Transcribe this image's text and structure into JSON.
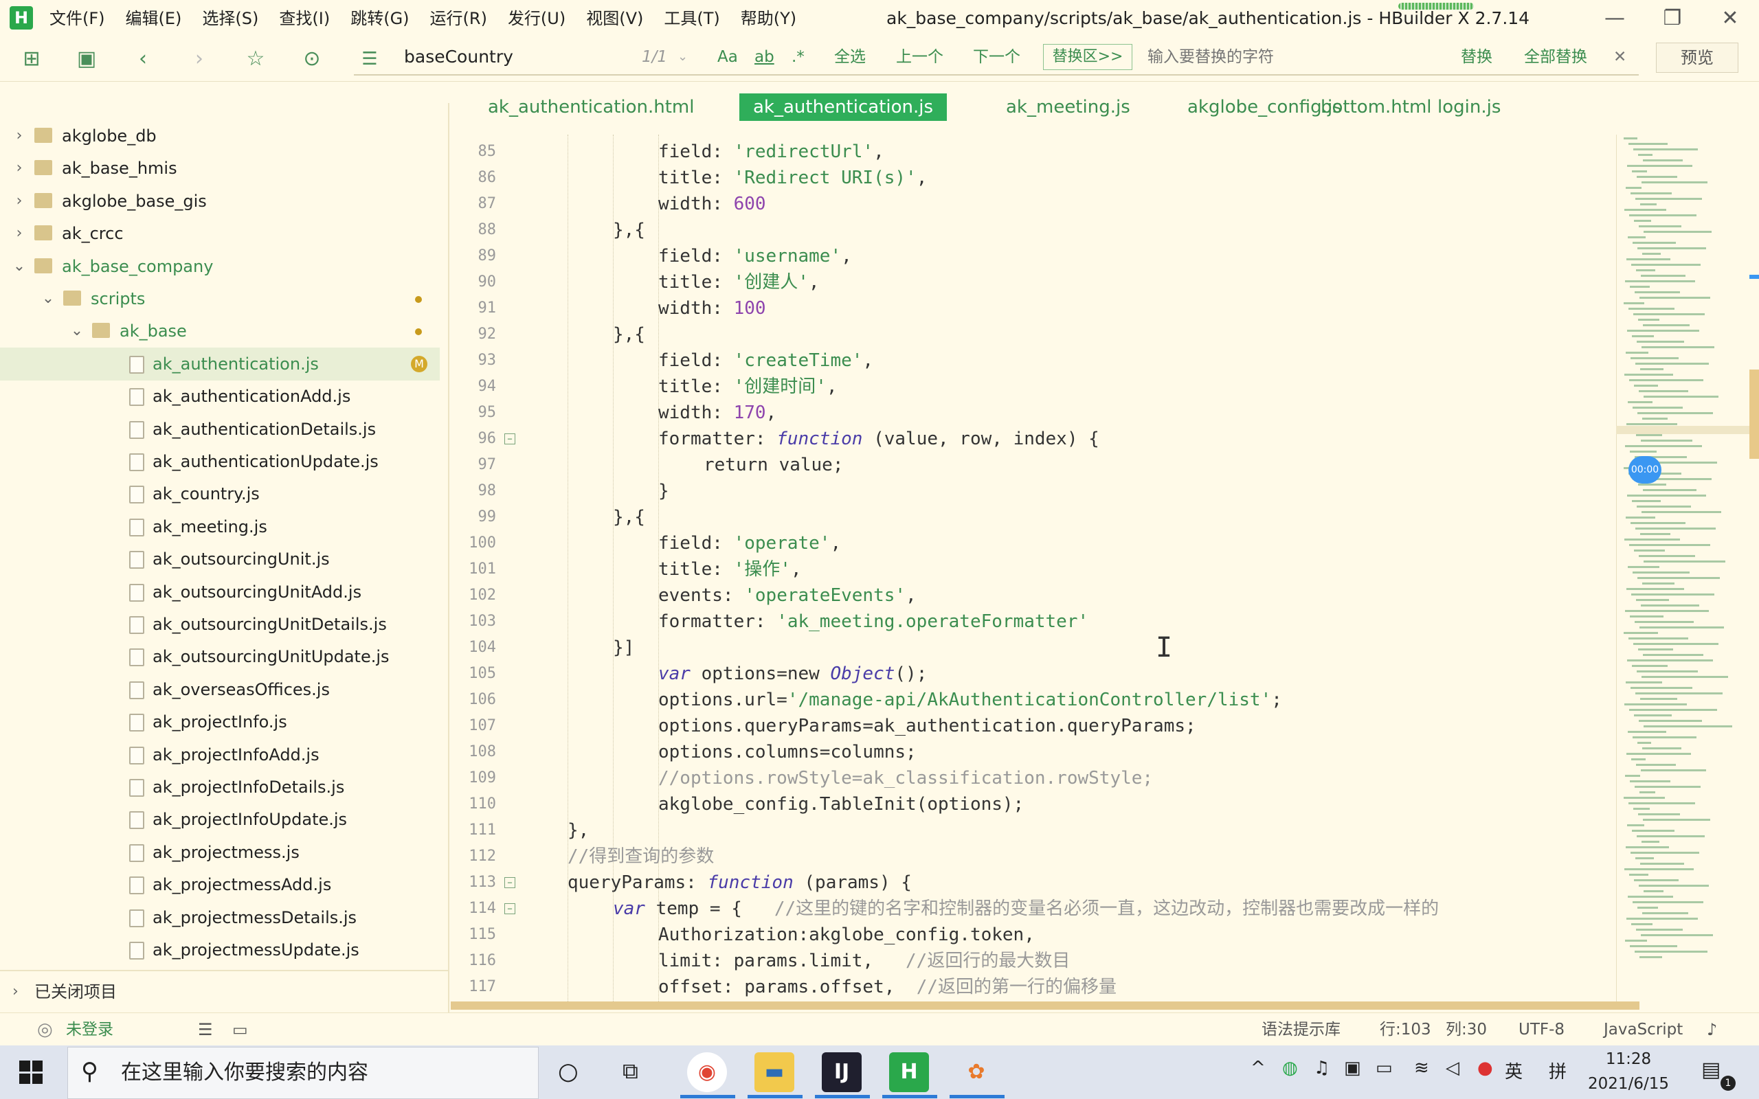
{
  "window": {
    "app_logo": "H",
    "title": "ak_base_company/scripts/ak_base/ak_authentication.js - HBuilder X 2.7.14",
    "controls": [
      "—",
      "❐",
      "✕"
    ]
  },
  "menu": [
    "文件(F)",
    "编辑(E)",
    "选择(S)",
    "查找(I)",
    "跳转(G)",
    "运行(R)",
    "发行(U)",
    "视图(V)",
    "工具(T)",
    "帮助(Y)"
  ],
  "find_bar": {
    "query": "baseCountry",
    "match_count": "1/1",
    "case_toggle": "Aa",
    "word_toggle": "ab",
    "regex_toggle": ".*",
    "select_all": "全选",
    "prev": "上一个",
    "next": "下一个",
    "replace_zone": "替换区>>",
    "replace_placeholder": "输入要替换的字符",
    "replace": "替换",
    "replace_all": "全部替换",
    "close": "✕",
    "preview": "预览"
  },
  "sidebar": {
    "items": [
      {
        "label": "akglobe_db",
        "type": "project",
        "state": "collapsed"
      },
      {
        "label": "ak_base_hmis",
        "type": "project",
        "state": "collapsed"
      },
      {
        "label": "akglobe_base_gis",
        "type": "project",
        "state": "collapsed"
      },
      {
        "label": "ak_crcc",
        "type": "project",
        "state": "collapsed"
      },
      {
        "label": "ak_base_company",
        "type": "project",
        "state": "expanded"
      },
      {
        "label": "scripts",
        "type": "folder",
        "state": "expanded",
        "modified": true
      },
      {
        "label": "ak_base",
        "type": "folder",
        "state": "expanded",
        "modified": true
      },
      {
        "label": "ak_authentication.js",
        "type": "file",
        "selected": true,
        "badge": "M"
      },
      {
        "label": "ak_authenticationAdd.js",
        "type": "file"
      },
      {
        "label": "ak_authenticationDetails.js",
        "type": "file"
      },
      {
        "label": "ak_authenticationUpdate.js",
        "type": "file"
      },
      {
        "label": "ak_country.js",
        "type": "file"
      },
      {
        "label": "ak_meeting.js",
        "type": "file"
      },
      {
        "label": "ak_outsourcingUnit.js",
        "type": "file"
      },
      {
        "label": "ak_outsourcingUnitAdd.js",
        "type": "file"
      },
      {
        "label": "ak_outsourcingUnitDetails.js",
        "type": "file"
      },
      {
        "label": "ak_outsourcingUnitUpdate.js",
        "type": "file"
      },
      {
        "label": "ak_overseasOffices.js",
        "type": "file"
      },
      {
        "label": "ak_projectInfo.js",
        "type": "file"
      },
      {
        "label": "ak_projectInfoAdd.js",
        "type": "file"
      },
      {
        "label": "ak_projectInfoDetails.js",
        "type": "file"
      },
      {
        "label": "ak_projectInfoUpdate.js",
        "type": "file"
      },
      {
        "label": "ak_projectmess.js",
        "type": "file"
      },
      {
        "label": "ak_projectmessAdd.js",
        "type": "file"
      },
      {
        "label": "ak_projectmessDetails.js",
        "type": "file"
      },
      {
        "label": "ak_projectmessUpdate.js",
        "type": "file"
      }
    ],
    "closed_projects": "已关闭项目"
  },
  "tabs": [
    {
      "label": "ak_authentication.html",
      "active": false
    },
    {
      "label": "ak_authentication.js",
      "active": true
    },
    {
      "label": "ak_meeting.js",
      "active": false
    },
    {
      "label": "akglobe_config.js",
      "active": false
    },
    {
      "label": "bottom.html",
      "active": false
    },
    {
      "label": "login.js",
      "active": false
    }
  ],
  "code": [
    {
      "n": "85",
      "indent": 12,
      "html": "field: <span class=\"str\">'redirectUrl'</span>,"
    },
    {
      "n": "86",
      "indent": 12,
      "html": "title: <span class=\"str\">'Redirect URI(s)'</span>,"
    },
    {
      "n": "87",
      "indent": 12,
      "html": "width: <span class=\"num\">600</span>"
    },
    {
      "n": "88",
      "indent": 8,
      "html": "},{"
    },
    {
      "n": "89",
      "indent": 12,
      "html": "field: <span class=\"str\">'username'</span>,"
    },
    {
      "n": "90",
      "indent": 12,
      "html": "title: <span class=\"str\">'创建人'</span>,"
    },
    {
      "n": "91",
      "indent": 12,
      "html": "width: <span class=\"num\">100</span>"
    },
    {
      "n": "92",
      "indent": 8,
      "html": "},{"
    },
    {
      "n": "93",
      "indent": 12,
      "html": "field: <span class=\"str\">'createTime'</span>,"
    },
    {
      "n": "94",
      "indent": 12,
      "html": "title: <span class=\"str\">'创建时间'</span>,"
    },
    {
      "n": "95",
      "indent": 12,
      "html": "width: <span class=\"num\">170</span>,"
    },
    {
      "n": "96",
      "indent": 12,
      "fold": true,
      "html": "formatter: <span class=\"fn\">function</span> (value, row, index) {"
    },
    {
      "n": "97",
      "indent": 16,
      "html": "return value;"
    },
    {
      "n": "98",
      "indent": 12,
      "html": "}"
    },
    {
      "n": "99",
      "indent": 8,
      "html": "},{"
    },
    {
      "n": "100",
      "indent": 12,
      "html": "field: <span class=\"str\">'operate'</span>,"
    },
    {
      "n": "101",
      "indent": 12,
      "html": "title: <span class=\"str\">'操作'</span>,"
    },
    {
      "n": "102",
      "indent": 12,
      "html": "events: <span class=\"str\">'operateEvents'</span>,"
    },
    {
      "n": "103",
      "indent": 12,
      "html": "formatter: <span class=\"str\">'ak_meeting.operateFormatter'</span>"
    },
    {
      "n": "104",
      "indent": 8,
      "html": "}]"
    },
    {
      "n": "105",
      "indent": 12,
      "html": "<span class=\"fn\">var</span> options=new <span class=\"fn\">Object</span>();"
    },
    {
      "n": "106",
      "indent": 12,
      "html": "options.url=<span class=\"str\">'/manage-api/AkAuthenticationController/list'</span>;"
    },
    {
      "n": "107",
      "indent": 12,
      "html": "options.queryParams=ak_authentication.queryParams;"
    },
    {
      "n": "108",
      "indent": 12,
      "html": "options.columns=columns;"
    },
    {
      "n": "109",
      "indent": 12,
      "html": "<span class=\"cm\">//options.rowStyle=ak_classification.rowStyle;</span>"
    },
    {
      "n": "110",
      "indent": 12,
      "html": "akglobe_config.TableInit(options);"
    },
    {
      "n": "111",
      "indent": 4,
      "html": "},"
    },
    {
      "n": "112",
      "indent": 4,
      "html": "<span class=\"cm\">//得到查询的参数</span>"
    },
    {
      "n": "113",
      "indent": 4,
      "fold": true,
      "html": "queryParams: <span class=\"fn\">function</span> (params) {"
    },
    {
      "n": "114",
      "indent": 8,
      "fold": true,
      "html": "<span class=\"fn\">var</span> temp = {   <span class=\"cm\">//这里的键的名字和控制器的变量名必须一直，这边改动，控制器也需要改成一样的</span>"
    },
    {
      "n": "115",
      "indent": 12,
      "html": "Authorization:akglobe_config.token,"
    },
    {
      "n": "116",
      "indent": 12,
      "html": "limit: params.limit,   <span class=\"cm\">//返回行的最大数目</span>"
    },
    {
      "n": "117",
      "indent": 12,
      "html": "offset: params.offset,  <span class=\"cm\">//返回的第一行的偏移量</span>"
    }
  ],
  "minimap": {
    "timer_badge": "00:00"
  },
  "status": {
    "login": "未登录",
    "syntax_lib": "语法提示库",
    "line": "行:103",
    "col": "列:30",
    "encoding": "UTF-8",
    "language": "JavaScript"
  },
  "taskbar": {
    "search_placeholder": "在这里输入你要搜索的内容",
    "apps": [
      "chrome",
      "file-explorer",
      "intellij",
      "hbuilder",
      "photos"
    ],
    "tray": {
      "ime_lang": "英",
      "ime_mode": "拼"
    },
    "clock": {
      "time": "11:28",
      "date": "2021/6/15"
    },
    "notifications": "1"
  }
}
